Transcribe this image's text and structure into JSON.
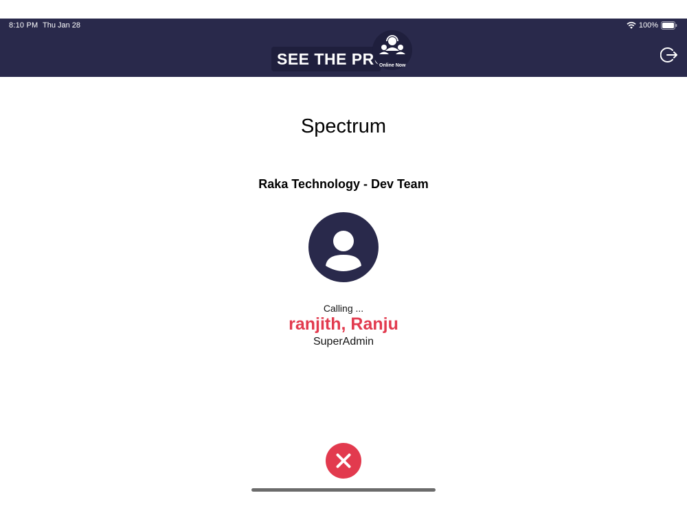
{
  "status_bar": {
    "time": "8:10 PM",
    "date": "Thu Jan 28",
    "battery": "100%",
    "wifi_icon": "wifi-icon",
    "battery_icon": "battery-full-icon"
  },
  "header": {
    "logo_text": "SEE THE PRO",
    "logo_subtext": "Online Now",
    "logout_icon": "logout-icon",
    "background_color": "#29294b"
  },
  "call": {
    "title": "Spectrum",
    "team": "Raka Technology - Dev Team",
    "status": "Calling ...",
    "caller_name": "ranjith, Ranju",
    "caller_role": "SuperAdmin",
    "avatar_icon": "person-avatar-icon",
    "end_call_icon": "close-icon",
    "accent_color": "#e23a4e"
  }
}
